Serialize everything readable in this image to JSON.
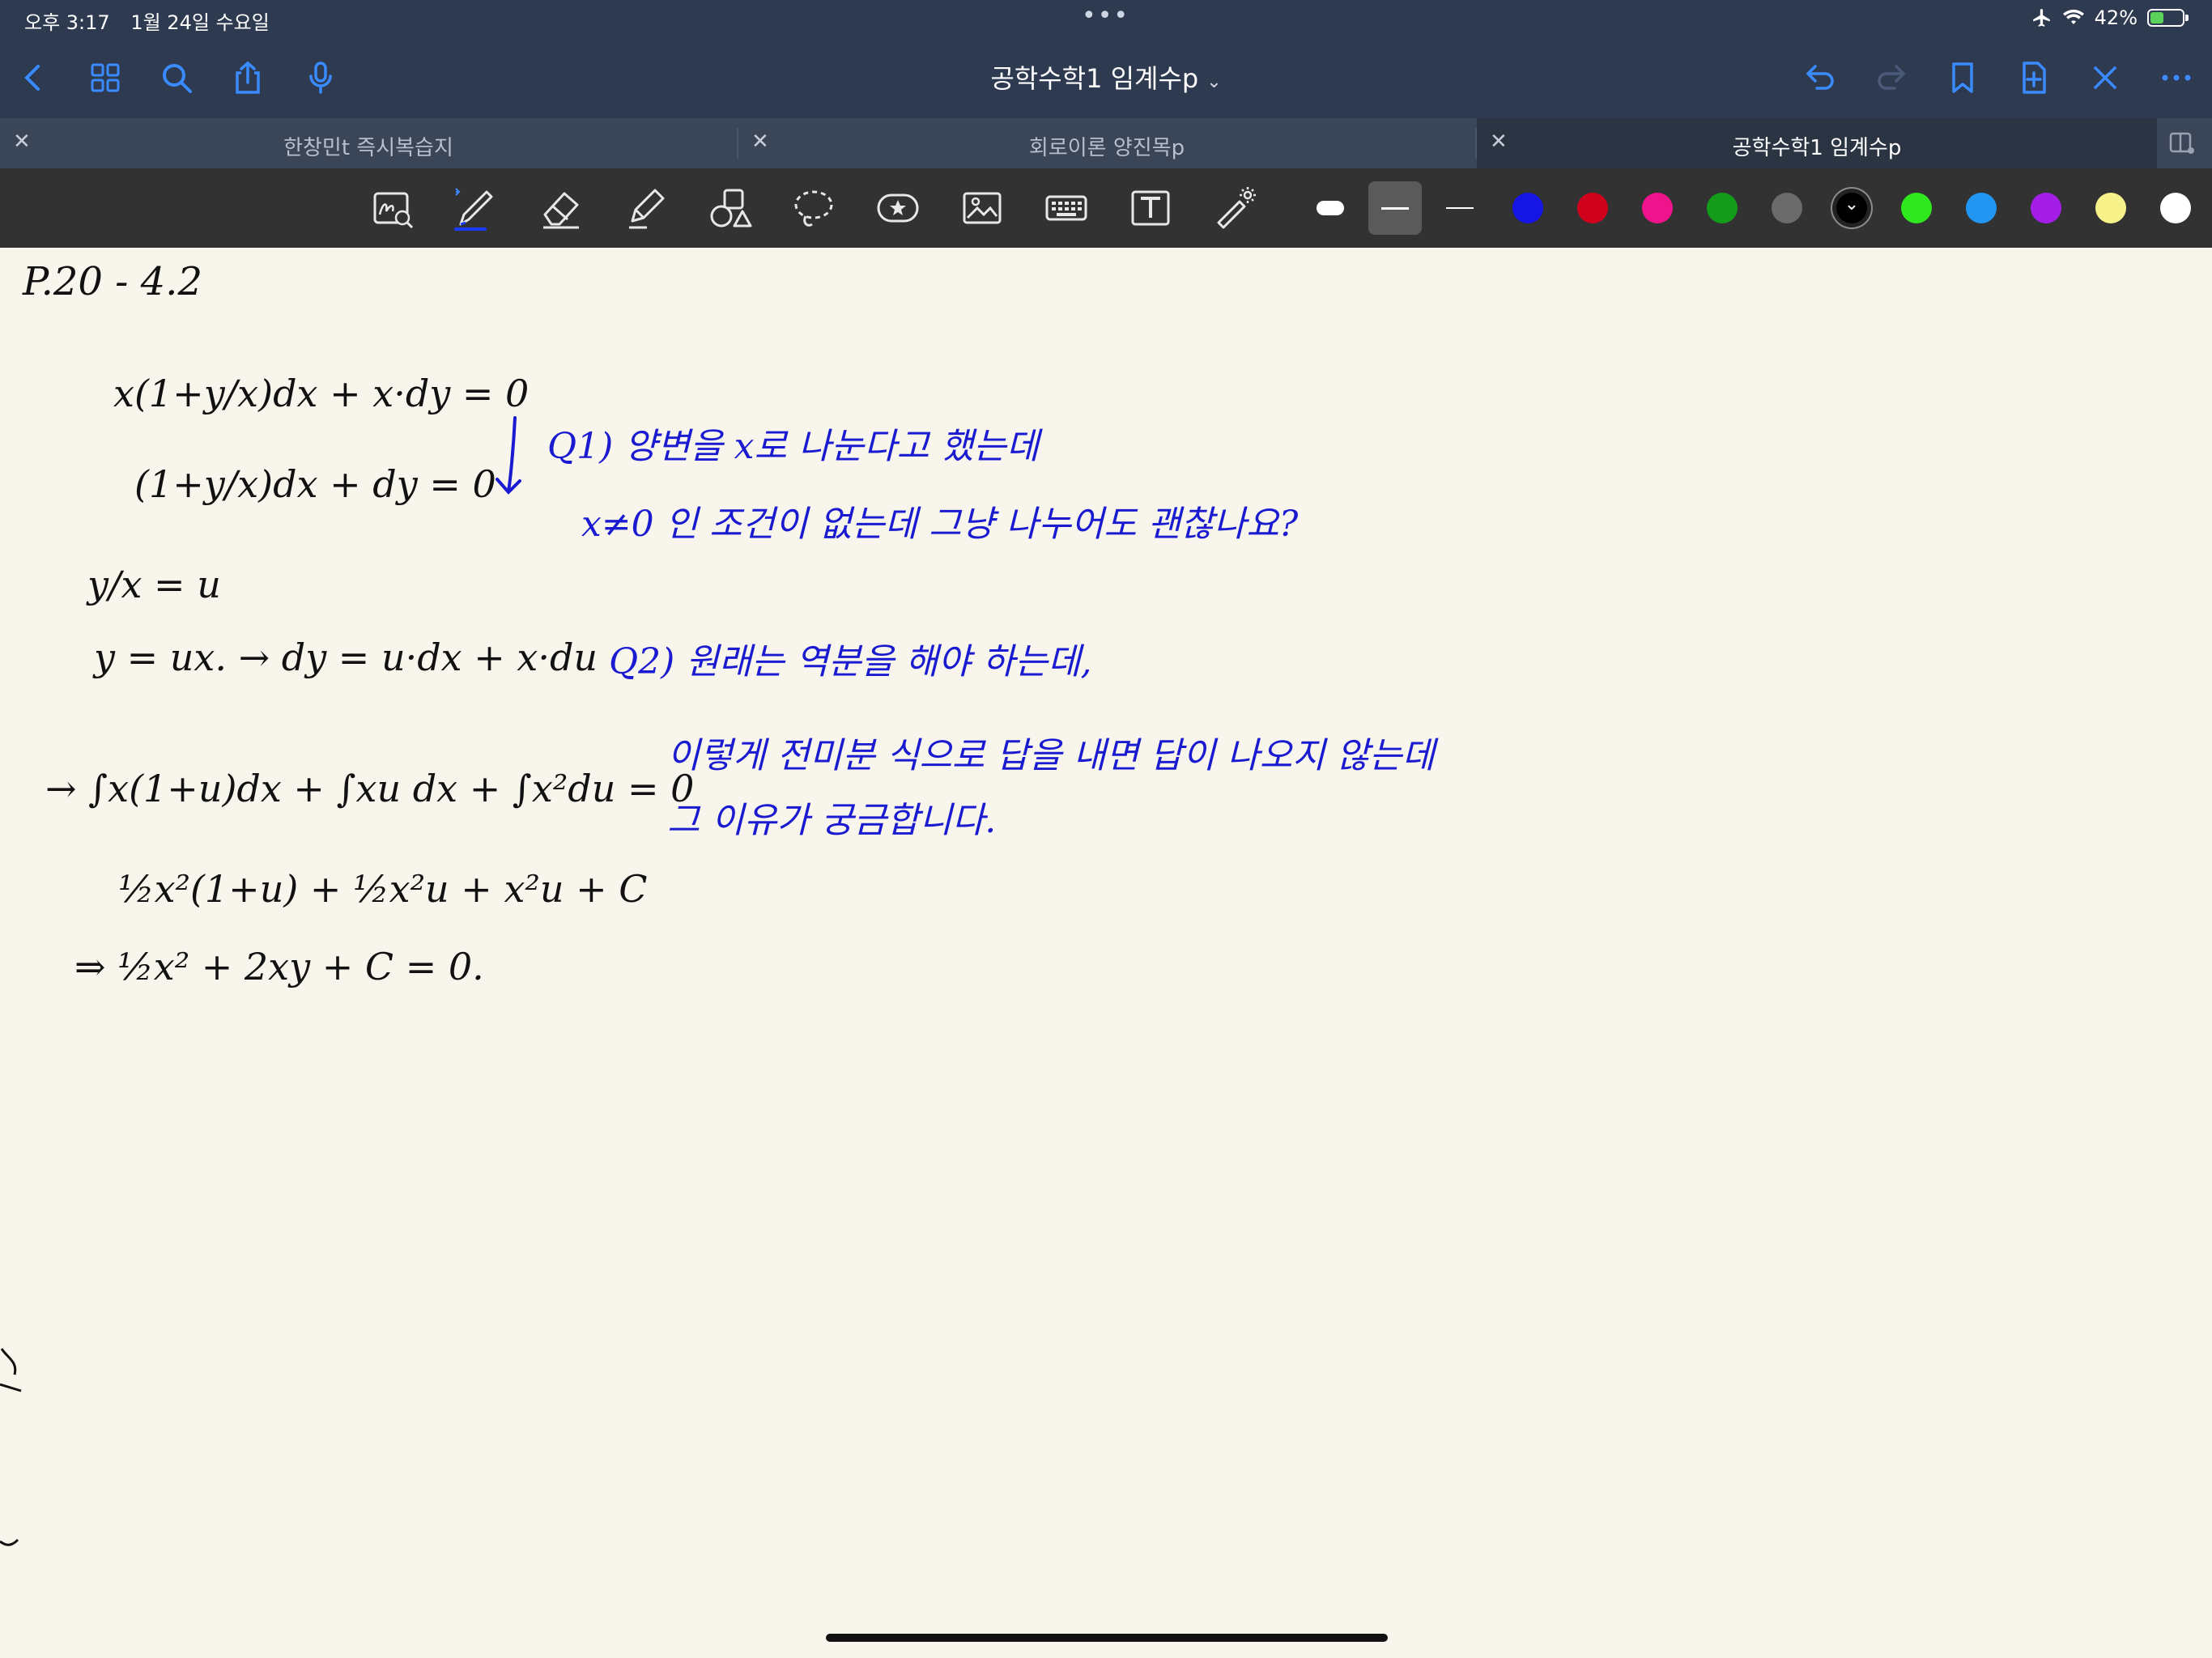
{
  "status_bar": {
    "time": "오후 3:17",
    "date": "1월 24일 수요일",
    "battery": "42%",
    "battery_level": 0.42,
    "icons": [
      "airplane-icon",
      "wifi-icon",
      "battery-charging-icon"
    ]
  },
  "nav": {
    "title": "공학수학1 임계수p",
    "left_icons": [
      "back-chevron-icon",
      "grid-icon",
      "search-icon",
      "share-icon",
      "microphone-icon"
    ],
    "right_icons": [
      "undo-icon",
      "redo-icon",
      "bookmark-icon",
      "add-page-icon",
      "close-icon",
      "more-icon"
    ]
  },
  "tabs": [
    {
      "label": "한창민t 즉시복습지",
      "active": false
    },
    {
      "label": "회로이론 양진목p",
      "active": false
    },
    {
      "label": "공학수학1 임계수p",
      "active": true
    }
  ],
  "toolbar": {
    "tools": [
      "zoom-lasso-tool",
      "pen-tool",
      "eraser-tool",
      "highlighter-tool",
      "shapes-tool",
      "lasso-tool",
      "sticker-tool",
      "image-tool",
      "keyboard-tool",
      "text-box-tool",
      "laser-pointer-tool"
    ],
    "selected_tool": "pen-tool",
    "stroke_sizes": [
      "thick",
      "medium",
      "thin"
    ],
    "selected_stroke": "medium",
    "colors": [
      "#1515e6",
      "#d0021b",
      "#f0148c",
      "#129c1a",
      "#6b6b6b",
      "#000000",
      "#2fe81d",
      "#2196f3",
      "#a41ee8",
      "#f7f28a",
      "#ffffff"
    ],
    "selected_color": "#000000"
  },
  "note": {
    "header": "P.20 - 4.2",
    "work_lines": [
      "x(1+y/x)dx + x·dy = 0",
      "(1+y/x)dx + dy = 0",
      "y/x = u",
      "y = ux. → dy = u·dx + x·du",
      "→ ∫x(1+u)dx + ∫xu dx + ∫x²du = 0",
      "½x²(1+u) + ½x²u + x²u + C",
      "⇒ ½x² + 2xy + C = 0."
    ],
    "question_1": [
      "Q1) 양변을 x로 나눈다고 했는데",
      "x≠0 인 조건이 없는데 그냥 나누어도 괜찮나요?"
    ],
    "question_2": [
      "Q2) 원래는 역분을 해야 하는데,",
      "이렇게 전미분 식으로 답을 내면 답이 나오지 않는데",
      "그 이유가 궁금합니다."
    ],
    "ink_colors": {
      "black": "#111111",
      "blue": "#1a1ad0"
    }
  }
}
